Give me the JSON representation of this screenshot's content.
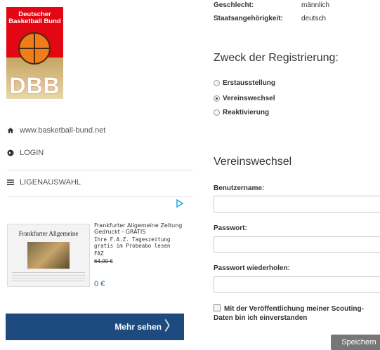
{
  "sidebar": {
    "logo": {
      "org_name": "Deutscher\nBasketball Bund",
      "abbr": "DBB"
    },
    "nav": [
      {
        "label": "www.basketball-bund.net",
        "icon": "home-icon"
      },
      {
        "label": "LOGIN",
        "icon": "login-icon"
      },
      {
        "label": "LIGENAUSWAHL",
        "icon": "list-icon"
      }
    ],
    "ad": {
      "masthead": "Frankfurter Allgemeine",
      "title": "Frankfurter Allgemeine Zeitung Gedruckt - GRATIS",
      "description": "Ihre F.A.Z. Tageszeitung gratis im Probeabo lesen",
      "source": "FAZ",
      "old_price": "64,90 €",
      "price": "0 €",
      "cta": "Mehr sehen"
    }
  },
  "main": {
    "info": [
      {
        "key": "Geschlecht:",
        "value": "männlich"
      },
      {
        "key": "Staatsangehörigkeit:",
        "value": "deutsch"
      }
    ],
    "purpose_heading": "Zweck der Registrierung:",
    "purpose_options": [
      {
        "label": "Erstausstellung",
        "checked": false
      },
      {
        "label": "Vereinswechsel",
        "checked": true
      },
      {
        "label": "Reaktivierung",
        "checked": false
      }
    ],
    "section_heading": "Vereinswechsel",
    "fields": {
      "username_label": "Benutzername:",
      "password_label": "Passwort:",
      "password_repeat_label": "Passwort wiederholen:"
    },
    "consent_label": "Mit der Veröffentlichung meiner Scouting-Daten bin ich einverstanden",
    "save_label": "Speichern"
  }
}
